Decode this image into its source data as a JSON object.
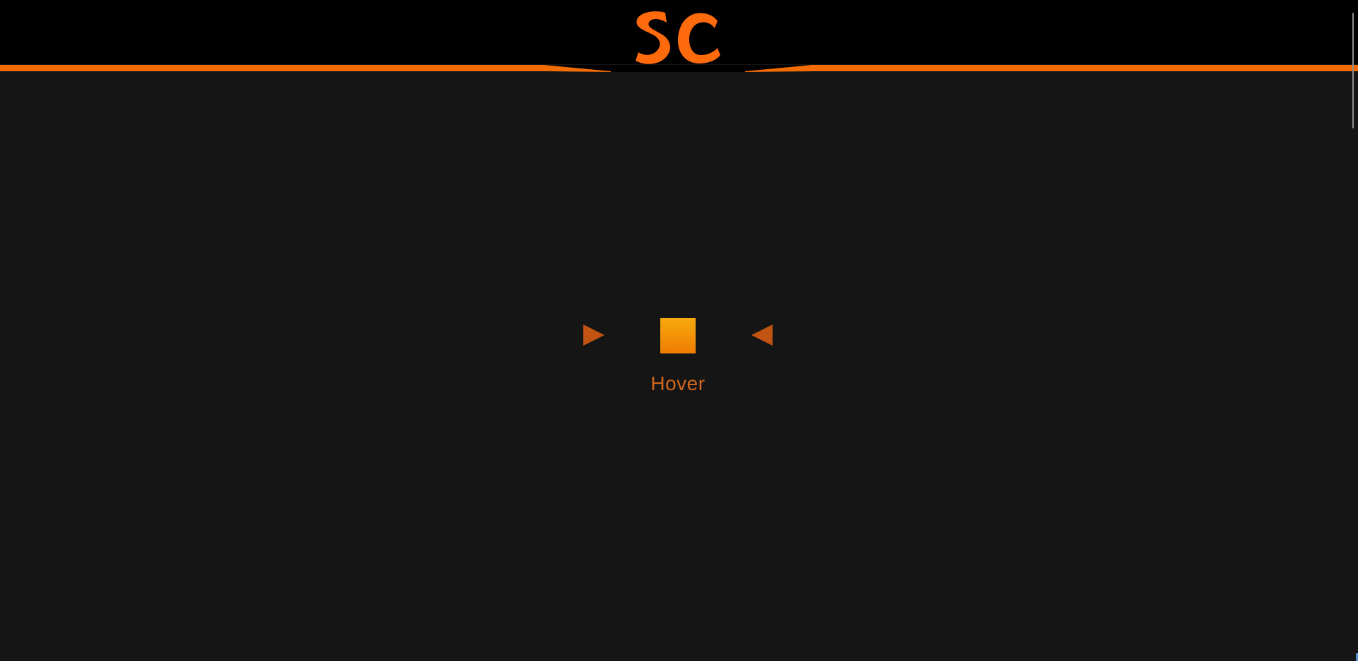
{
  "header": {
    "logo_text": "SC",
    "accent_color": "#f16c05",
    "background_color": "#000000"
  },
  "main": {
    "background_color": "#151515",
    "hover_widget": {
      "label": "Hover",
      "left_arrow_icon": "triangle-right-icon",
      "right_arrow_icon": "triangle-left-icon",
      "square_gradient": [
        "#f6a90e",
        "#ef7c02"
      ],
      "arrow_color": "#c15412",
      "label_color": "#d2681a"
    }
  }
}
